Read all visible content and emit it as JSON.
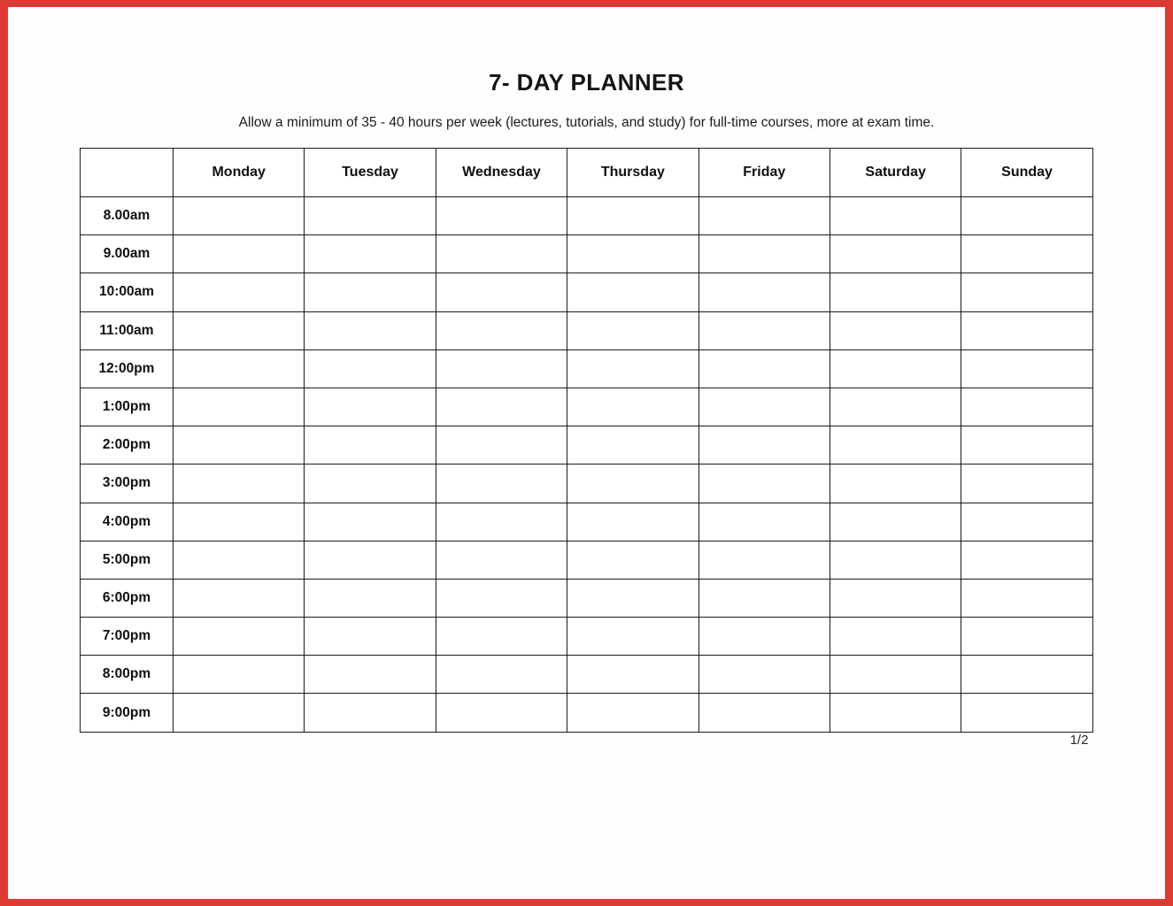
{
  "document": {
    "title": "7- DAY PLANNER",
    "subtitle": "Allow a minimum of 35 - 40 hours per week (lectures, tutorials, and study) for full-time courses, more at exam time.",
    "page_indicator": "1/2",
    "border_color": "#de3a34",
    "page_background": "#ffffff",
    "grid_line_color": "#1a1a1a",
    "text_color": "#101010"
  },
  "table": {
    "corner_header": "",
    "day_headers": [
      "Monday",
      "Tuesday",
      "Wednesday",
      "Thursday",
      "Friday",
      "Saturday",
      "Sunday"
    ],
    "time_labels": [
      "8.00am",
      "9.00am",
      "10:00am",
      "11:00am",
      "12:00pm",
      "1:00pm",
      "2:00pm",
      "3:00pm",
      "4:00pm",
      "5:00pm",
      "6:00pm",
      "7:00pm",
      "8:00pm",
      "9:00pm"
    ],
    "cells": [
      [
        "",
        "",
        "",
        "",
        "",
        "",
        ""
      ],
      [
        "",
        "",
        "",
        "",
        "",
        "",
        ""
      ],
      [
        "",
        "",
        "",
        "",
        "",
        "",
        ""
      ],
      [
        "",
        "",
        "",
        "",
        "",
        "",
        ""
      ],
      [
        "",
        "",
        "",
        "",
        "",
        "",
        ""
      ],
      [
        "",
        "",
        "",
        "",
        "",
        "",
        ""
      ],
      [
        "",
        "",
        "",
        "",
        "",
        "",
        ""
      ],
      [
        "",
        "",
        "",
        "",
        "",
        "",
        ""
      ],
      [
        "",
        "",
        "",
        "",
        "",
        "",
        ""
      ],
      [
        "",
        "",
        "",
        "",
        "",
        "",
        ""
      ],
      [
        "",
        "",
        "",
        "",
        "",
        "",
        ""
      ],
      [
        "",
        "",
        "",
        "",
        "",
        "",
        ""
      ],
      [
        "",
        "",
        "",
        "",
        "",
        "",
        ""
      ],
      [
        "",
        "",
        "",
        "",
        "",
        "",
        ""
      ]
    ]
  }
}
